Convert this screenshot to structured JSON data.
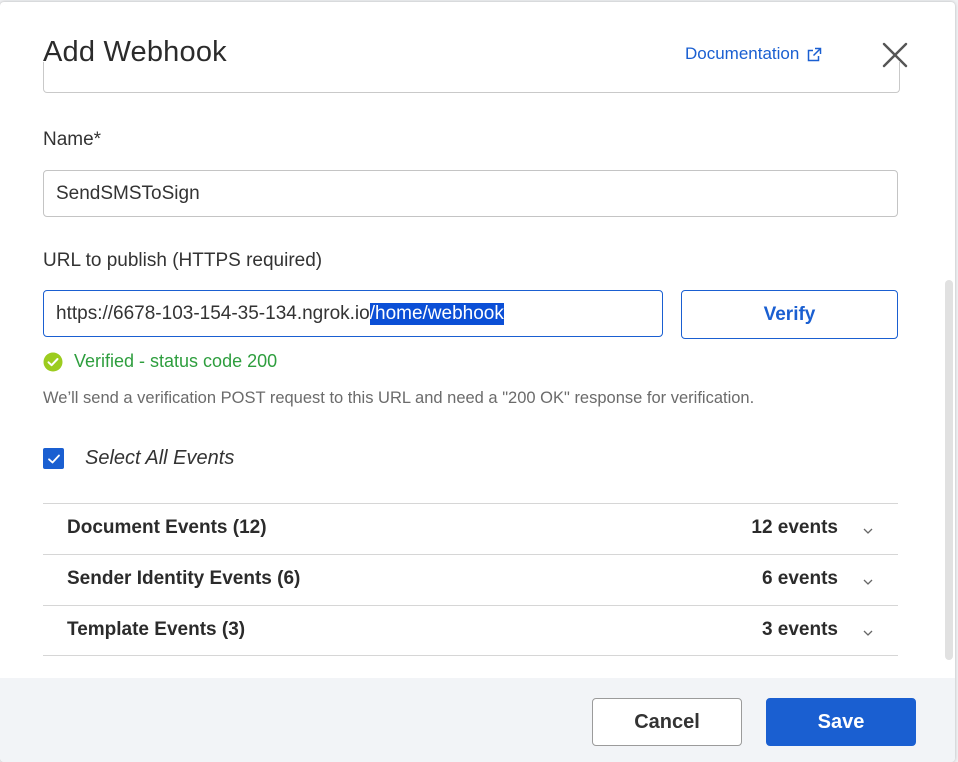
{
  "modal": {
    "title": "Add Webhook",
    "documentation_link": "Documentation"
  },
  "form": {
    "name_label": "Name*",
    "name_value": "SendSMSToSign",
    "url_label": "URL to publish (HTTPS required)",
    "url_value_plain": "https://6678-103-154-35-134.ngrok.io",
    "url_value_selected": "/home/webhook",
    "verify_button": "Verify",
    "verified_status": "Verified - status code 200",
    "help_text": "We’ll send a verification POST request to this URL and need a \"200 OK\" response for verification.",
    "select_all_label": "Select All Events",
    "select_all_checked": true
  },
  "events": [
    {
      "name": "Document Events (12)",
      "count": "12 events"
    },
    {
      "name": "Sender Identity Events (6)",
      "count": "6 events"
    },
    {
      "name": "Template Events (3)",
      "count": "3 events"
    }
  ],
  "footer": {
    "cancel_label": "Cancel",
    "save_label": "Save"
  },
  "colors": {
    "accent": "#1a5fd1",
    "success": "#2e9e3e",
    "selection": "#0b4fd6",
    "footer_bg": "#f2f4f7"
  },
  "icons": {
    "external_link": "external-link-icon",
    "close": "close-icon",
    "verified": "check-circle-icon",
    "checkbox": "checkmark-icon",
    "expand": "chevron-down-icon"
  }
}
